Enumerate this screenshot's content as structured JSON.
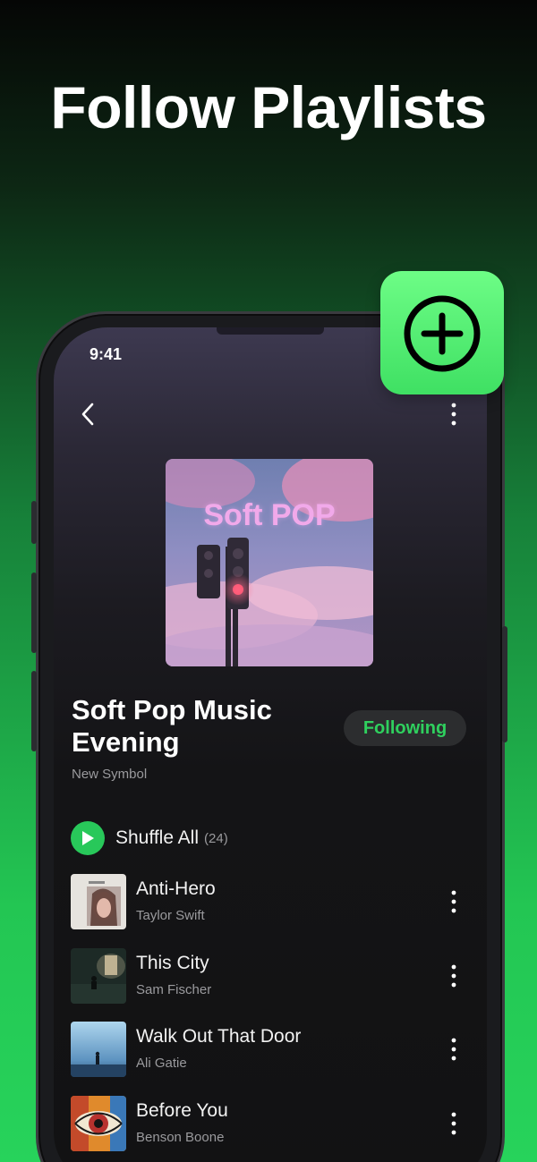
{
  "headline": "Follow Playlists",
  "status_bar": {
    "time": "9:41"
  },
  "cover": {
    "text": "Soft POP"
  },
  "playlist": {
    "title_line1": "Soft Pop Music",
    "title_line2": "Evening",
    "author": "New Symbol",
    "follow_label": "Following"
  },
  "shuffle": {
    "label": "Shuffle All",
    "count": "(24)"
  },
  "songs": [
    {
      "title": "Anti-Hero",
      "artist": "Taylor Swift"
    },
    {
      "title": "This City",
      "artist": "Sam Fischer"
    },
    {
      "title": "Walk Out That Door",
      "artist": "Ali Gatie"
    },
    {
      "title": "Before You",
      "artist": "Benson Boone"
    }
  ],
  "colors": {
    "accent": "#2fd05e",
    "add_tile": "#5ff47c",
    "background_top": "#050605",
    "background_bottom": "#27d35b"
  },
  "icons": {
    "back": "chevron-left-icon",
    "more": "more-vertical-icon",
    "play": "play-icon",
    "add": "plus-circle-icon"
  }
}
